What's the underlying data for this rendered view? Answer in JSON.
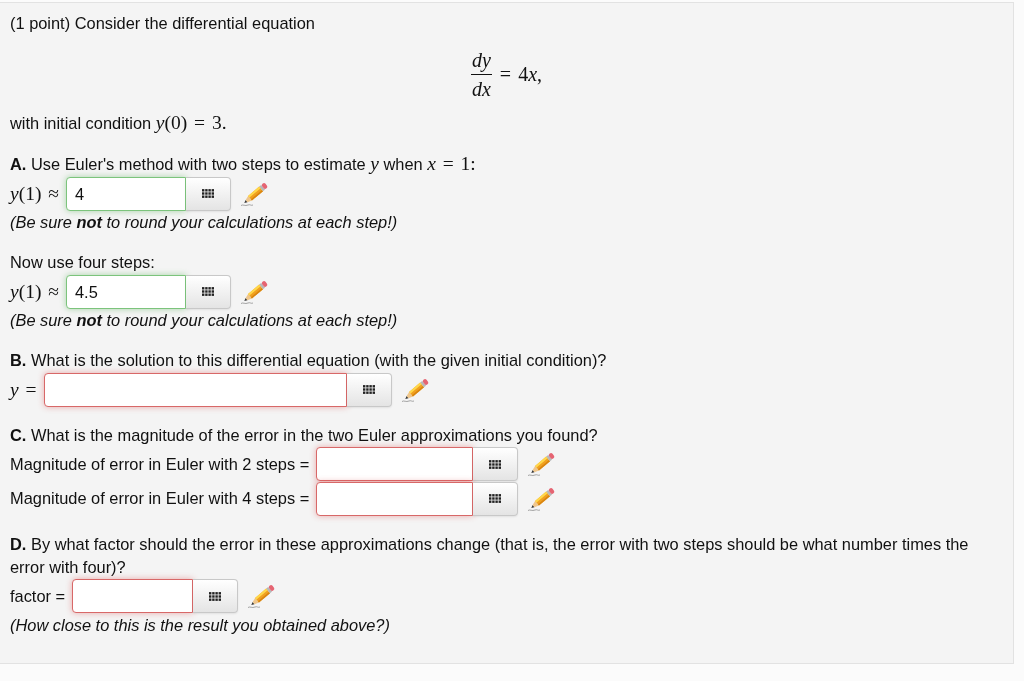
{
  "intro": "(1 point) Consider the differential equation",
  "equation": {
    "numerator": "dy",
    "denominator": "dx",
    "rhs": [
      {
        "kind": "roman",
        "text": "= 4"
      },
      {
        "kind": "italic",
        "text": "x"
      },
      {
        "kind": "roman",
        "text": ","
      }
    ]
  },
  "condition": [
    {
      "kind": "text",
      "text": "with initial condition "
    },
    {
      "kind": "math",
      "text": "*y*(0) = 3."
    }
  ],
  "parts": [
    {
      "question": [
        {
          "kind": "text",
          "text": "**A.** Use Euler's method with two steps to estimate "
        },
        {
          "kind": "math",
          "text": "*y*"
        },
        {
          "kind": "text",
          "text": " when "
        },
        {
          "kind": "math",
          "text": "*x* = 1:"
        }
      ],
      "items": [
        {
          "kind": "answer",
          "label": [
            {
              "kind": "math",
              "text": "*y*(1) ≈"
            }
          ],
          "value": "4",
          "correct": true
        },
        {
          "kind": "note",
          "text": "(Be sure **not** to round your calculations at each step!)"
        },
        {
          "kind": "text",
          "text": "Now use four steps:"
        },
        {
          "kind": "answer",
          "label": [
            {
              "kind": "math",
              "text": "*y*(1) ≈"
            }
          ],
          "value": "4.5",
          "correct": true
        },
        {
          "kind": "note",
          "text": "(Be sure **not** to round your calculations at each step!)"
        }
      ]
    },
    {
      "question": [
        {
          "kind": "text",
          "text": "**B.** What is the solution to this differential equation (with the given initial condition)?"
        }
      ],
      "items": [
        {
          "kind": "answer",
          "label": [
            {
              "kind": "math",
              "text": "*y* ="
            }
          ],
          "correct": false
        }
      ]
    },
    {
      "question": [
        {
          "kind": "text",
          "text": "**C.** What is the magnitude of the error in the two Euler approximations you found?"
        }
      ],
      "items": [
        {
          "kind": "answer",
          "label": [
            {
              "kind": "text",
              "text": "Magnitude of error in Euler with 2 steps ="
            }
          ],
          "correct": false
        },
        {
          "kind": "answer",
          "label": [
            {
              "kind": "text",
              "text": "Magnitude of error in Euler with 4 steps ="
            }
          ],
          "correct": false
        }
      ]
    },
    {
      "question": [
        {
          "kind": "text",
          "text": "**D.** By what factor should the error in these approximations change (that is, the error with two steps should be what number times the error with four)?"
        }
      ],
      "items": [
        {
          "kind": "answer",
          "label": [
            {
              "kind": "text",
              "text": "factor ="
            }
          ],
          "correct": false
        },
        {
          "kind": "note",
          "text": "(How close to this is the result you obtained above?)"
        }
      ]
    }
  ]
}
